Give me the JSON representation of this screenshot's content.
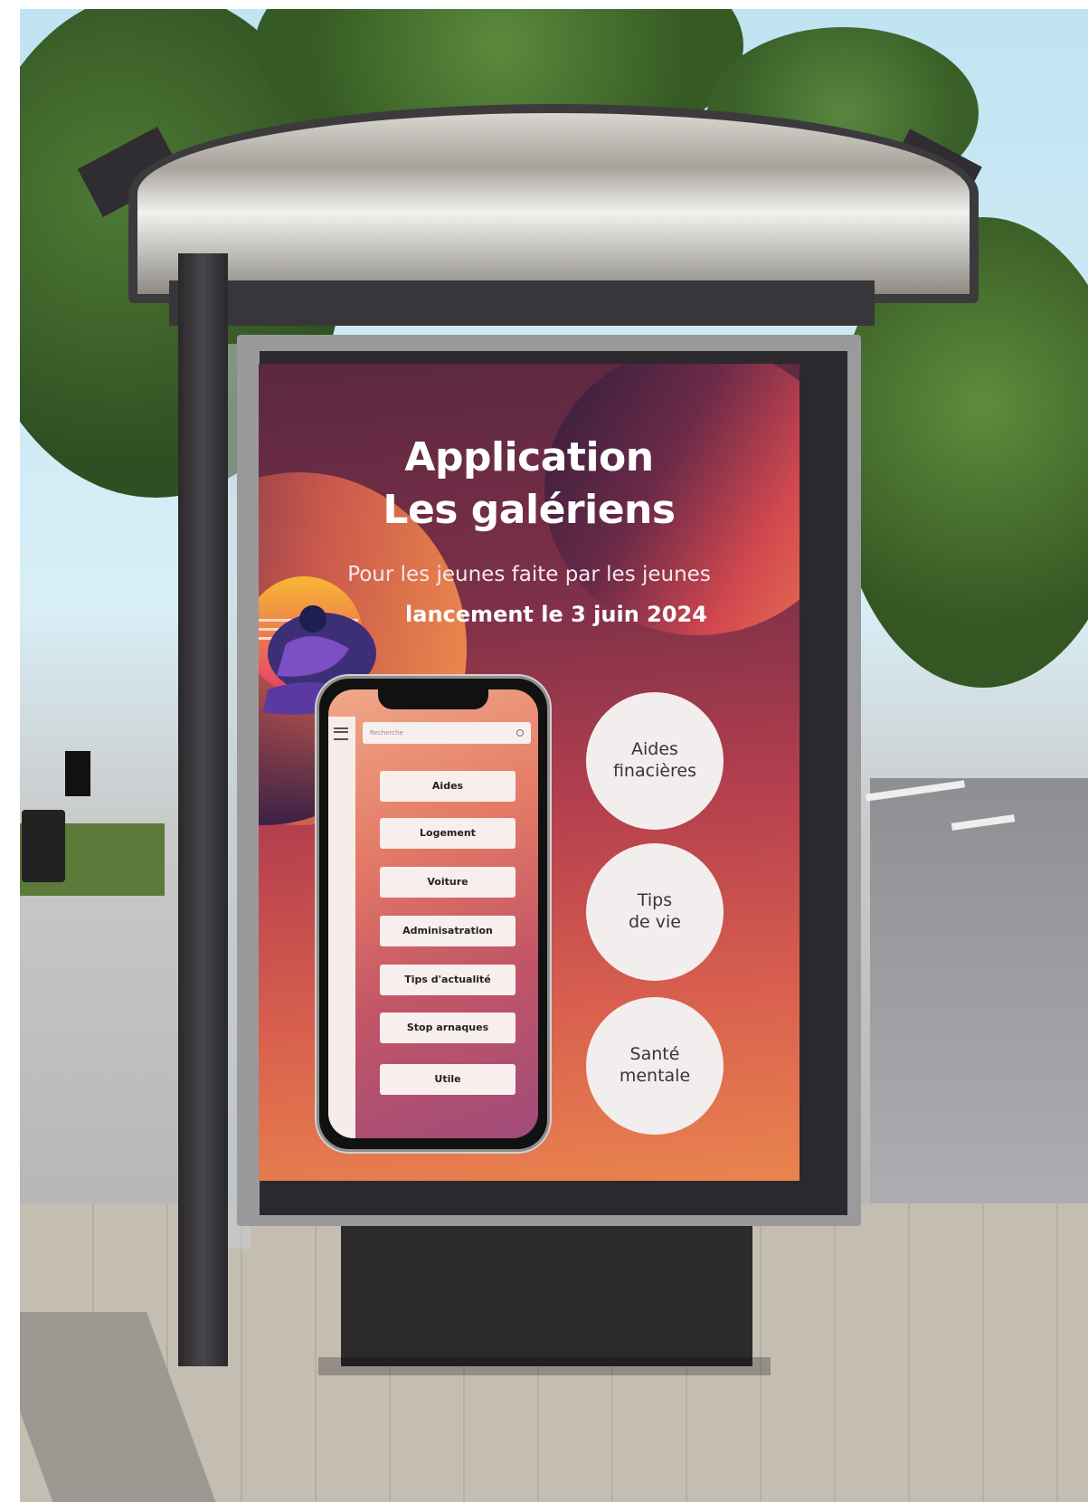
{
  "poster": {
    "title_line1": "Application",
    "title_line2": "Les galériens",
    "subtitle": "Pour les jeunes faite par les jeunes",
    "launch": "lancement le 3 juin 2024"
  },
  "phone": {
    "search_placeholder": "Recherche",
    "menu_items": [
      "Aides",
      "Logement",
      "Voiture",
      "Adminisatration",
      "Tips d'actualité",
      "Stop arnaques",
      "Utile"
    ]
  },
  "circles": [
    {
      "label": "Aides\nfinacières"
    },
    {
      "label": "Tips\nde vie"
    },
    {
      "label": "Santé\nmentale"
    }
  ],
  "colors": {
    "poster_top": "#5a2840",
    "poster_bottom": "#e9844e",
    "circle_bg": "#f3eeee",
    "button_bg": "#f8eeee"
  }
}
